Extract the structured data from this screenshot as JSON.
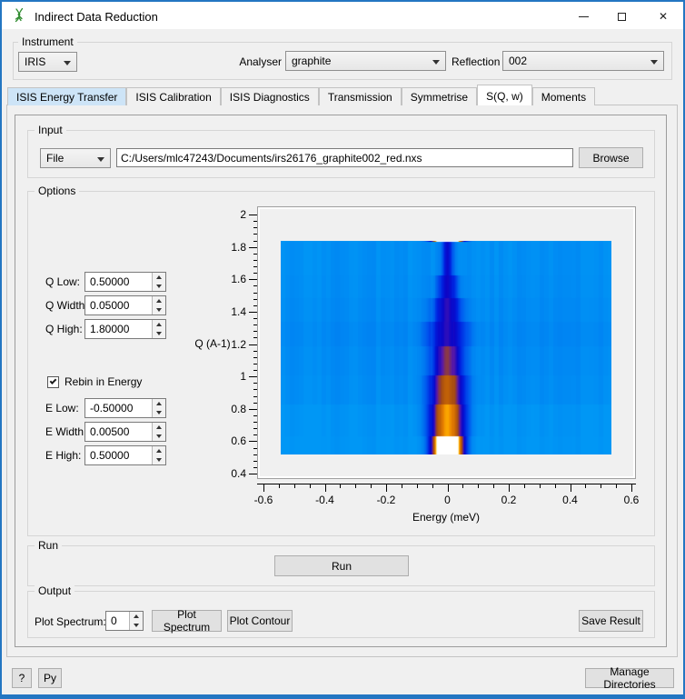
{
  "window": {
    "title": "Indirect Data Reduction",
    "icon": "mantid-mantis-icon",
    "controls": {
      "minimize": "minimize",
      "maximize": "maximize",
      "close": "close"
    }
  },
  "colors": {
    "window_border": "#2376c2",
    "titlebar_bg": "#ffffff",
    "dialog_bg": "#f0f0f0",
    "tab_highlight": "#cde4f7",
    "button_bg": "#e1e1e1",
    "heatmap_background": "#0097f5",
    "heatmap_hot": "#ffffff"
  },
  "instrument": {
    "group_label": "Instrument",
    "instrument_value": "IRIS",
    "analyser_label": "Analyser",
    "analyser_value": "graphite",
    "reflection_label": "Reflection",
    "reflection_value": "002"
  },
  "tabs": [
    {
      "label": "ISIS Energy Transfer",
      "state": "highlighted"
    },
    {
      "label": "ISIS Calibration",
      "state": "normal"
    },
    {
      "label": "ISIS Diagnostics",
      "state": "normal"
    },
    {
      "label": "Transmission",
      "state": "normal"
    },
    {
      "label": "Symmetrise",
      "state": "normal"
    },
    {
      "label": "S(Q, w)",
      "state": "selected"
    },
    {
      "label": "Moments",
      "state": "normal"
    }
  ],
  "input": {
    "group_label": "Input",
    "source_selector_value": "File",
    "file_path": "C:/Users/mlc47243/Documents/irs26176_graphite002_red.nxs",
    "browse_label": "Browse"
  },
  "options": {
    "group_label": "Options",
    "q_fields": [
      {
        "label": "Q Low:",
        "value": "0.50000"
      },
      {
        "label": "Q Width:",
        "value": "0.05000"
      },
      {
        "label": "Q High:",
        "value": "1.80000"
      }
    ],
    "rebin_checkbox": {
      "label": "Rebin in Energy",
      "checked": true
    },
    "e_fields": [
      {
        "label": "E Low:",
        "value": "-0.50000"
      },
      {
        "label": "E Width:",
        "value": "0.00500"
      },
      {
        "label": "E High:",
        "value": "0.50000"
      }
    ]
  },
  "run": {
    "group_label": "Run",
    "run_button": "Run"
  },
  "output": {
    "group_label": "Output",
    "plot_spectrum_label": "Plot Spectrum:",
    "spectrum_value": "0",
    "plot_spectrum_button": "Plot Spectrum",
    "plot_contour_button": "Plot Contour",
    "save_result_button": "Save Result"
  },
  "footer": {
    "help_button": "?",
    "python_button": "Py",
    "manage_directories_button": "Manage Directories"
  },
  "chart_data": {
    "type": "heatmap",
    "xlabel": "Energy (meV)",
    "ylabel": "Q (A-1)",
    "x_axis": {
      "min": -0.6,
      "max": 0.6,
      "major_ticks": [
        -0.6,
        -0.4,
        -0.2,
        0,
        0.2,
        0.4,
        0.6
      ],
      "minor_step": 0.05
    },
    "y_axis": {
      "min": 0.4,
      "max": 2,
      "major_ticks": [
        2,
        1.8,
        1.6,
        1.4,
        1.2,
        1,
        0.8,
        0.6,
        0.4
      ],
      "minor_step": 0.04
    },
    "data_extent": {
      "e_min": -0.545,
      "e_max": 0.535,
      "q_min": 0.52,
      "q_max": 1.84
    },
    "description": "S(Q,w) intensity map: elastic line at E=0 whose intensity falls with Q; white-hot at lowest Q, orange at mid-low Q, fading to a narrow dark-blue line at high Q on an azure background",
    "q_bands": [
      {
        "q0": 0.52,
        "q1": 0.63,
        "amplitude": 1.8,
        "width": 0.045,
        "bg": 0.0
      },
      {
        "q0": 0.63,
        "q1": 0.83,
        "amplitude": 0.86,
        "width": 0.055,
        "bg": 0.01
      },
      {
        "q0": 0.83,
        "q1": 1.01,
        "amplitude": 0.66,
        "width": 0.055,
        "bg": 0.04
      },
      {
        "q0": 1.01,
        "q1": 1.19,
        "amplitude": 0.52,
        "width": 0.05,
        "bg": 0.05
      },
      {
        "q0": 1.19,
        "q1": 1.34,
        "amplitude": 0.38,
        "width": 0.06,
        "bg": 0.065
      },
      {
        "q0": 1.34,
        "q1": 1.49,
        "amplitude": 0.4,
        "width": 0.045,
        "bg": 0.05
      },
      {
        "q0": 1.49,
        "q1": 1.63,
        "amplitude": 0.37,
        "width": 0.033,
        "bg": 0.04
      },
      {
        "q0": 1.63,
        "q1": 1.84,
        "amplitude": 0.35,
        "width": 0.02,
        "bg": 0.035
      }
    ],
    "colormap": [
      [
        0.0,
        "#0097f5"
      ],
      [
        0.1,
        "#0080f2"
      ],
      [
        0.2,
        "#0055ee"
      ],
      [
        0.3,
        "#0022e0"
      ],
      [
        0.4,
        "#0b06c8"
      ],
      [
        0.5,
        "#5a18a8"
      ],
      [
        0.6,
        "#a34a14"
      ],
      [
        0.7,
        "#c26207"
      ],
      [
        0.8,
        "#e77f00"
      ],
      [
        0.88,
        "#ffae00"
      ],
      [
        0.94,
        "#ffe27a"
      ],
      [
        1.0,
        "#ffffff"
      ]
    ]
  }
}
